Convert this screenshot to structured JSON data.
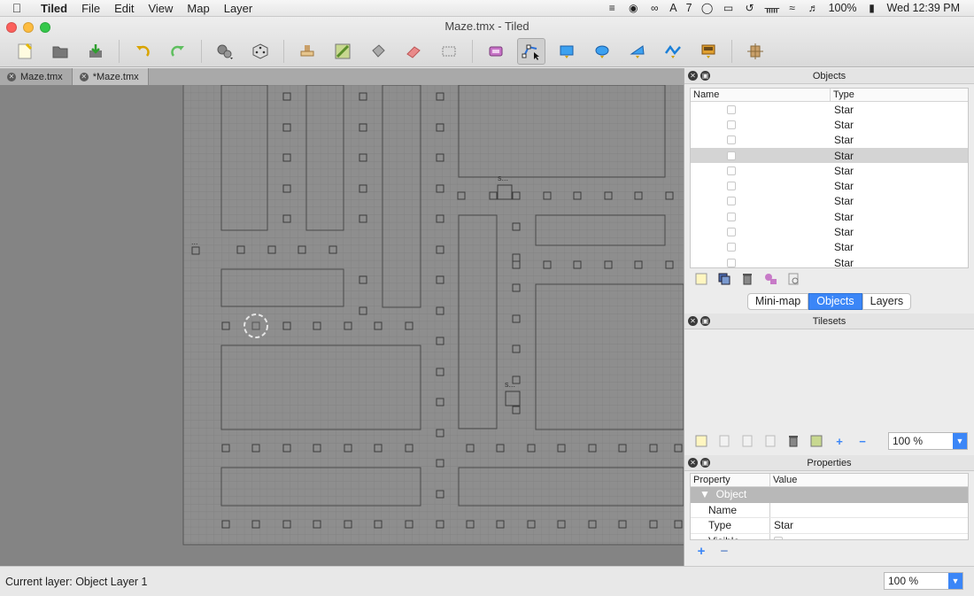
{
  "menubar": {
    "app_name": "Tiled",
    "items": [
      "File",
      "Edit",
      "View",
      "Map",
      "Layer"
    ],
    "adobe_badge": "7",
    "battery": "100%",
    "clock": "Wed 12:39 PM"
  },
  "window": {
    "title": "Maze.tmx - Tiled"
  },
  "tabs": [
    {
      "label": "Maze.tmx"
    },
    {
      "label": "*Maze.tmx"
    }
  ],
  "map": {
    "object_labels": [
      "...",
      "s...",
      "s..."
    ]
  },
  "objects_panel": {
    "title": "Objects",
    "col_name": "Name",
    "col_type": "Type",
    "rows": [
      "Star",
      "Star",
      "Star",
      "Star",
      "Star",
      "Star",
      "Star",
      "Star",
      "Star",
      "Star",
      "Star"
    ],
    "selected_index": 3
  },
  "view_tabs": {
    "minimap": "Mini-map",
    "objects": "Objects",
    "layers": "Layers"
  },
  "tilesets_panel": {
    "title": "Tilesets",
    "zoom": "100 %"
  },
  "properties_panel": {
    "title": "Properties",
    "col_property": "Property",
    "col_value": "Value",
    "group": "Object",
    "rows": [
      {
        "key": "Name",
        "value": ""
      },
      {
        "key": "Type",
        "value": "Star"
      },
      {
        "key": "Visible",
        "value": ""
      }
    ]
  },
  "statusbar": {
    "current_layer": "Current layer: Object Layer 1",
    "zoom": "100 %"
  },
  "colors": {
    "accent": "#3b86f7",
    "map_bg": "#848484",
    "map_area": "#8e8e8e"
  }
}
